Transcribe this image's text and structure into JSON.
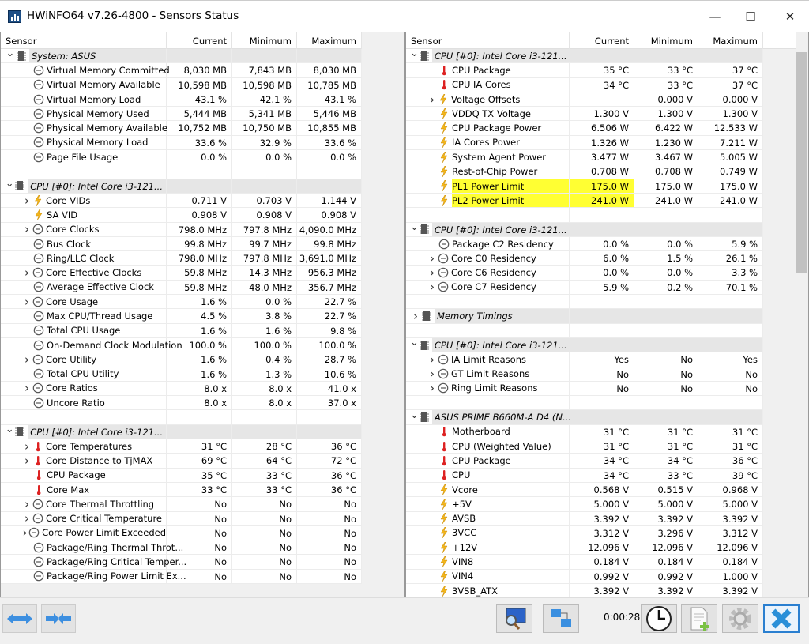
{
  "window": {
    "title": "HWiNFO64 v7.26-4800 - Sensors Status",
    "minimize": "—",
    "maximize": "☐",
    "close": "✕"
  },
  "columns": {
    "sensor": "Sensor",
    "current": "Current",
    "minimum": "Minimum",
    "maximum": "Maximum"
  },
  "left_rows": [
    {
      "t": "g",
      "e": "v",
      "l": "System: ASUS"
    },
    {
      "t": "s",
      "i": "clock",
      "l": "Virtual Memory Committed",
      "v": [
        "8,030 MB",
        "7,843 MB",
        "8,030 MB"
      ]
    },
    {
      "t": "s",
      "i": "clock",
      "l": "Virtual Memory Available",
      "v": [
        "10,598 MB",
        "10,598 MB",
        "10,785 MB"
      ]
    },
    {
      "t": "s",
      "i": "clock",
      "l": "Virtual Memory Load",
      "v": [
        "43.1 %",
        "42.1 %",
        "43.1 %"
      ]
    },
    {
      "t": "s",
      "i": "clock",
      "l": "Physical Memory Used",
      "v": [
        "5,444 MB",
        "5,341 MB",
        "5,446 MB"
      ]
    },
    {
      "t": "s",
      "i": "clock",
      "l": "Physical Memory Available",
      "v": [
        "10,752 MB",
        "10,750 MB",
        "10,855 MB"
      ]
    },
    {
      "t": "s",
      "i": "clock",
      "l": "Physical Memory Load",
      "v": [
        "33.6 %",
        "32.9 %",
        "33.6 %"
      ]
    },
    {
      "t": "s",
      "i": "clock",
      "l": "Page File Usage",
      "v": [
        "0.0 %",
        "0.0 %",
        "0.0 %"
      ]
    },
    {
      "t": "b"
    },
    {
      "t": "g",
      "e": "v",
      "l": "CPU [#0]: Intel Core i3-121..."
    },
    {
      "t": "s",
      "e": ">",
      "i": "bolt",
      "l": "Core VIDs",
      "v": [
        "0.711 V",
        "0.703 V",
        "1.144 V"
      ]
    },
    {
      "t": "s",
      "i": "bolt",
      "l": "SA VID",
      "v": [
        "0.908 V",
        "0.908 V",
        "0.908 V"
      ]
    },
    {
      "t": "s",
      "e": ">",
      "i": "clock",
      "l": "Core Clocks",
      "v": [
        "798.0 MHz",
        "797.8 MHz",
        "4,090.0 MHz"
      ]
    },
    {
      "t": "s",
      "i": "clock",
      "l": "Bus Clock",
      "v": [
        "99.8 MHz",
        "99.7 MHz",
        "99.8 MHz"
      ]
    },
    {
      "t": "s",
      "i": "clock",
      "l": "Ring/LLC Clock",
      "v": [
        "798.0 MHz",
        "797.8 MHz",
        "3,691.0 MHz"
      ]
    },
    {
      "t": "s",
      "e": ">",
      "i": "clock",
      "l": "Core Effective Clocks",
      "v": [
        "59.8 MHz",
        "14.3 MHz",
        "956.3 MHz"
      ]
    },
    {
      "t": "s",
      "i": "clock",
      "l": "Average Effective Clock",
      "v": [
        "59.8 MHz",
        "48.0 MHz",
        "356.7 MHz"
      ]
    },
    {
      "t": "s",
      "e": ">",
      "i": "clock",
      "l": "Core Usage",
      "v": [
        "1.6 %",
        "0.0 %",
        "22.7 %"
      ]
    },
    {
      "t": "s",
      "i": "clock",
      "l": "Max CPU/Thread Usage",
      "v": [
        "4.5 %",
        "3.8 %",
        "22.7 %"
      ]
    },
    {
      "t": "s",
      "i": "clock",
      "l": "Total CPU Usage",
      "v": [
        "1.6 %",
        "1.6 %",
        "9.8 %"
      ]
    },
    {
      "t": "s",
      "i": "clock",
      "l": "On-Demand Clock Modulation",
      "v": [
        "100.0 %",
        "100.0 %",
        "100.0 %"
      ]
    },
    {
      "t": "s",
      "e": ">",
      "i": "clock",
      "l": "Core Utility",
      "v": [
        "1.6 %",
        "0.4 %",
        "28.7 %"
      ]
    },
    {
      "t": "s",
      "i": "clock",
      "l": "Total CPU Utility",
      "v": [
        "1.6 %",
        "1.3 %",
        "10.6 %"
      ]
    },
    {
      "t": "s",
      "e": ">",
      "i": "clock",
      "l": "Core Ratios",
      "v": [
        "8.0 x",
        "8.0 x",
        "41.0 x"
      ]
    },
    {
      "t": "s",
      "i": "clock",
      "l": "Uncore Ratio",
      "v": [
        "8.0 x",
        "8.0 x",
        "37.0 x"
      ]
    },
    {
      "t": "b"
    },
    {
      "t": "g",
      "e": "v",
      "l": "CPU [#0]: Intel Core i3-121..."
    },
    {
      "t": "s",
      "e": ">",
      "i": "therm",
      "l": "Core Temperatures",
      "v": [
        "31 °C",
        "28 °C",
        "36 °C"
      ]
    },
    {
      "t": "s",
      "e": ">",
      "i": "therm",
      "l": "Core Distance to TjMAX",
      "v": [
        "69 °C",
        "64 °C",
        "72 °C"
      ]
    },
    {
      "t": "s",
      "i": "therm",
      "l": "CPU Package",
      "v": [
        "35 °C",
        "33 °C",
        "36 °C"
      ]
    },
    {
      "t": "s",
      "i": "therm",
      "l": "Core Max",
      "v": [
        "33 °C",
        "33 °C",
        "36 °C"
      ]
    },
    {
      "t": "s",
      "e": ">",
      "i": "clock",
      "l": "Core Thermal Throttling",
      "v": [
        "No",
        "No",
        "No"
      ]
    },
    {
      "t": "s",
      "e": ">",
      "i": "clock",
      "l": "Core Critical Temperature",
      "v": [
        "No",
        "No",
        "No"
      ]
    },
    {
      "t": "s",
      "e": ">",
      "i": "clock",
      "l": "Core Power Limit Exceeded",
      "v": [
        "No",
        "No",
        "No"
      ]
    },
    {
      "t": "s",
      "i": "clock",
      "l": "Package/Ring Thermal Throt...",
      "v": [
        "No",
        "No",
        "No"
      ]
    },
    {
      "t": "s",
      "i": "clock",
      "l": "Package/Ring Critical Temper...",
      "v": [
        "No",
        "No",
        "No"
      ]
    },
    {
      "t": "s",
      "i": "clock",
      "l": "Package/Ring Power Limit Ex...",
      "v": [
        "No",
        "No",
        "No"
      ]
    }
  ],
  "right_rows": [
    {
      "t": "g",
      "e": "v",
      "l": "CPU [#0]: Intel Core i3-121..."
    },
    {
      "t": "s",
      "i": "therm",
      "l": "CPU Package",
      "v": [
        "35 °C",
        "33 °C",
        "37 °C"
      ]
    },
    {
      "t": "s",
      "i": "therm",
      "l": "CPU IA Cores",
      "v": [
        "34 °C",
        "33 °C",
        "37 °C"
      ]
    },
    {
      "t": "s",
      "e": ">",
      "i": "bolt",
      "l": "Voltage Offsets",
      "v": [
        "",
        "0.000 V",
        "0.000 V"
      ]
    },
    {
      "t": "s",
      "i": "bolt",
      "l": "VDDQ TX Voltage",
      "v": [
        "1.300 V",
        "1.300 V",
        "1.300 V"
      ]
    },
    {
      "t": "s",
      "i": "bolt",
      "l": "CPU Package Power",
      "v": [
        "6.506 W",
        "6.422 W",
        "12.533 W"
      ]
    },
    {
      "t": "s",
      "i": "bolt",
      "l": "IA Cores Power",
      "v": [
        "1.326 W",
        "1.230 W",
        "7.211 W"
      ]
    },
    {
      "t": "s",
      "i": "bolt",
      "l": "System Agent Power",
      "v": [
        "3.477 W",
        "3.467 W",
        "5.005 W"
      ]
    },
    {
      "t": "s",
      "i": "bolt",
      "l": "Rest-of-Chip Power",
      "v": [
        "0.708 W",
        "0.708 W",
        "0.749 W"
      ]
    },
    {
      "t": "s",
      "i": "bolt",
      "l": "PL1 Power Limit",
      "v": [
        "175.0 W",
        "175.0 W",
        "175.0 W"
      ],
      "h": true
    },
    {
      "t": "s",
      "i": "bolt",
      "l": "PL2 Power Limit",
      "v": [
        "241.0 W",
        "241.0 W",
        "241.0 W"
      ],
      "h": true
    },
    {
      "t": "b"
    },
    {
      "t": "g",
      "e": "v",
      "l": "CPU [#0]: Intel Core i3-121..."
    },
    {
      "t": "s",
      "i": "clock",
      "l": "Package C2 Residency",
      "v": [
        "0.0 %",
        "0.0 %",
        "5.9 %"
      ]
    },
    {
      "t": "s",
      "e": ">",
      "i": "clock",
      "l": "Core C0 Residency",
      "v": [
        "6.0 %",
        "1.5 %",
        "26.1 %"
      ]
    },
    {
      "t": "s",
      "e": ">",
      "i": "clock",
      "l": "Core C6 Residency",
      "v": [
        "0.0 %",
        "0.0 %",
        "3.3 %"
      ]
    },
    {
      "t": "s",
      "e": ">",
      "i": "clock",
      "l": "Core C7 Residency",
      "v": [
        "5.9 %",
        "0.2 %",
        "70.1 %"
      ]
    },
    {
      "t": "b"
    },
    {
      "t": "g",
      "e": ">",
      "l": "Memory Timings"
    },
    {
      "t": "b"
    },
    {
      "t": "g",
      "e": "v",
      "l": "CPU [#0]: Intel Core i3-121..."
    },
    {
      "t": "s",
      "e": ">",
      "i": "clock",
      "l": "IA Limit Reasons",
      "v": [
        "Yes",
        "No",
        "Yes"
      ]
    },
    {
      "t": "s",
      "e": ">",
      "i": "clock",
      "l": "GT Limit Reasons",
      "v": [
        "No",
        "No",
        "No"
      ]
    },
    {
      "t": "s",
      "e": ">",
      "i": "clock",
      "l": "Ring Limit Reasons",
      "v": [
        "No",
        "No",
        "No"
      ]
    },
    {
      "t": "b"
    },
    {
      "t": "g",
      "e": "v",
      "l": "ASUS PRIME B660M-A D4 (N..."
    },
    {
      "t": "s",
      "i": "therm",
      "l": "Motherboard",
      "v": [
        "31 °C",
        "31 °C",
        "31 °C"
      ]
    },
    {
      "t": "s",
      "i": "therm",
      "l": "CPU (Weighted Value)",
      "v": [
        "31 °C",
        "31 °C",
        "31 °C"
      ]
    },
    {
      "t": "s",
      "i": "therm",
      "l": "CPU Package",
      "v": [
        "34 °C",
        "34 °C",
        "36 °C"
      ]
    },
    {
      "t": "s",
      "i": "therm",
      "l": "CPU",
      "v": [
        "34 °C",
        "33 °C",
        "39 °C"
      ]
    },
    {
      "t": "s",
      "i": "bolt",
      "l": "Vcore",
      "v": [
        "0.568 V",
        "0.515 V",
        "0.968 V"
      ]
    },
    {
      "t": "s",
      "i": "bolt",
      "l": "+5V",
      "v": [
        "5.000 V",
        "5.000 V",
        "5.000 V"
      ]
    },
    {
      "t": "s",
      "i": "bolt",
      "l": "AVSB",
      "v": [
        "3.392 V",
        "3.392 V",
        "3.392 V"
      ]
    },
    {
      "t": "s",
      "i": "bolt",
      "l": "3VCC",
      "v": [
        "3.312 V",
        "3.296 V",
        "3.312 V"
      ]
    },
    {
      "t": "s",
      "i": "bolt",
      "l": "+12V",
      "v": [
        "12.096 V",
        "12.096 V",
        "12.096 V"
      ]
    },
    {
      "t": "s",
      "i": "bolt",
      "l": "VIN8",
      "v": [
        "0.184 V",
        "0.184 V",
        "0.184 V"
      ]
    },
    {
      "t": "s",
      "i": "bolt",
      "l": "VIN4",
      "v": [
        "0.992 V",
        "0.992 V",
        "1.000 V"
      ]
    },
    {
      "t": "s",
      "i": "bolt",
      "l": "3VSB_ATX",
      "v": [
        "3.392 V",
        "3.392 V",
        "3.392 V"
      ]
    }
  ],
  "toolbar": {
    "timer": "0:00:28"
  },
  "colors": {
    "highlight": "#ffff33",
    "accent": "#2a7fd0"
  }
}
